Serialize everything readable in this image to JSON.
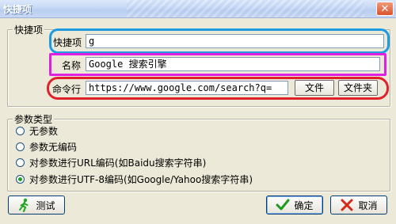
{
  "window": {
    "title": "快捷项",
    "close_glyph": "✕"
  },
  "group_shortcut": {
    "label": "快捷项",
    "shortcut_label": "快捷项",
    "shortcut_value": "g",
    "name_label": "名称",
    "name_value": "Google 搜索引擎",
    "command_label": "命令行",
    "command_value": "https://www.google.com/search?q=",
    "file_button": "文件",
    "folder_button": "文件夹"
  },
  "group_params": {
    "label": "参数类型",
    "options": [
      {
        "label": "无参数",
        "checked": false
      },
      {
        "label": "参数无编码",
        "checked": false
      },
      {
        "label": "对参数进行URL编码(如Baidu搜索字符串)",
        "checked": false
      },
      {
        "label": "对参数进行UTF-8编码(如Google/Yahoo搜索字符串)",
        "checked": true
      }
    ]
  },
  "buttons": {
    "test": "测试",
    "ok": "确定",
    "cancel": "取消"
  },
  "icons": {
    "test": "running-man-icon",
    "ok": "check-icon",
    "cancel": "x-icon"
  },
  "colors": {
    "highlight_shortcut": "#1e9be0",
    "highlight_name": "#e020e0",
    "highlight_command": "#e0202a",
    "ok_check": "#1c9a1c",
    "cancel_x": "#d42a1a"
  }
}
